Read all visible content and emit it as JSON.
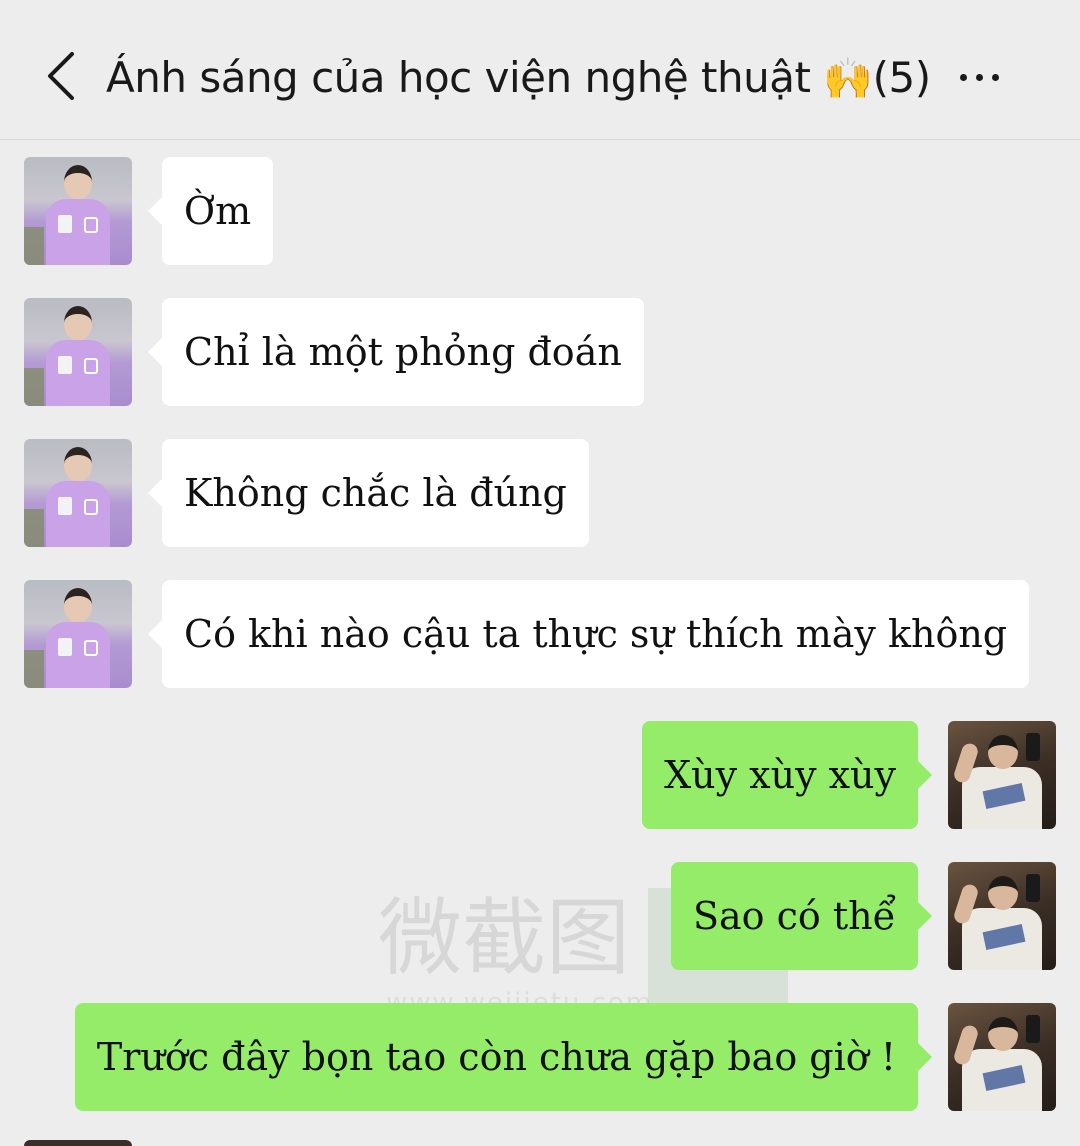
{
  "header": {
    "title": "Ánh sáng của học viện nghệ thuật",
    "emoji": "🙌",
    "member_count": "(5)",
    "back_icon": "chevron-left-icon",
    "more_icon": "more-dots-icon"
  },
  "watermark": {
    "text": "微截图",
    "url": "www.weijietu.com"
  },
  "messages": [
    {
      "side": "left",
      "text": "Ờm"
    },
    {
      "side": "left",
      "text": "Chỉ là một phỏng đoán"
    },
    {
      "side": "left",
      "text": "Không chắc là đúng"
    },
    {
      "side": "left",
      "text": "Có khi nào cậu ta thực sự thích mày không"
    },
    {
      "side": "right",
      "text": "Xùy xùy xùy"
    },
    {
      "side": "right",
      "text": "Sao có thể"
    },
    {
      "side": "right",
      "text": "Trước đây bọn tao còn chưa gặp bao giờ !"
    }
  ],
  "colors": {
    "background": "#ededed",
    "incoming_bubble": "#ffffff",
    "outgoing_bubble": "#95ec69"
  }
}
